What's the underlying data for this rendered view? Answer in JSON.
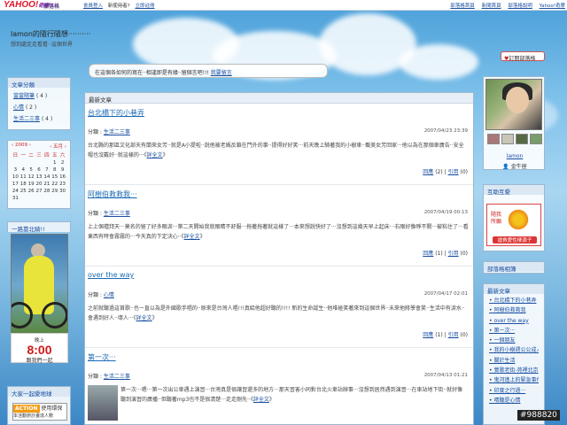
{
  "topbar": {
    "logo": "YAHOO!",
    "logo_sub": "奇摩",
    "blog_label": "部落格",
    "member_login": "會員登入",
    "new_user": "新使用者?",
    "register": "立即註冊",
    "right_links": [
      "部落格首頁",
      "新聞首頁",
      "部落格說明",
      "Yahoo!奇摩"
    ]
  },
  "header": {
    "title": "lamon的隨行隨想‧‧‧‧‧‧‧‧‧‧",
    "subtitle": "想到處走走看看‧‧這個世界"
  },
  "notice": {
    "text": "在這個各如何的寫在‧‧相逢即是有緣‧‧留個言吧!!!",
    "link": "我要留言"
  },
  "subscribe": "訂閱部落格",
  "categories": {
    "title": "文章分類",
    "items": [
      {
        "name": "當當隨筆",
        "count": "( 4 )"
      },
      {
        "name": "心情",
        "count": "( 2 )"
      },
      {
        "name": "生活二三事",
        "count": "( 4 )"
      }
    ]
  },
  "calendar": {
    "year": "‹ 2009 ›",
    "month": "‹ 五月 ›",
    "headers": [
      "日",
      "一",
      "二",
      "三",
      "四",
      "五",
      "六"
    ],
    "days": [
      "",
      "",
      "",
      "",
      "",
      "1",
      "2",
      "3",
      "4",
      "5",
      "6",
      "7",
      "8",
      "9",
      "10",
      "11",
      "12",
      "13",
      "14",
      "15",
      "16",
      "17",
      "18",
      "19",
      "20",
      "21",
      "22",
      "23",
      "24",
      "25",
      "26",
      "27",
      "28",
      "29",
      "30",
      "31"
    ]
  },
  "left_widget": {
    "title": "一路靠北騎!!",
    "promo_top": "晚上",
    "promo_time": "8:00",
    "promo_bottom": "跟我們一起"
  },
  "earth": {
    "title": "大家一起愛地球",
    "action": "ACTION",
    "action_text": "使用環保",
    "action_sub": "本活動辦計畫達人數"
  },
  "main": {
    "heading": "最新文章",
    "cat_label": "分類 :",
    "reply_label": "回應",
    "ref_label": "引用",
    "posts": [
      {
        "title": "台北橋下的小巷弄",
        "category": "生活二三事",
        "date": "2007/04/23 23:39",
        "body": "台北縣的那區文化部天有蘭來女芳‧‧就是A小提啦‧‧說他被老媽反鎖在門外的事‧‧提得好好笑‧‧‧前天晚上騎著我的小樹車‧‧載美女芳回家‧‧‧他以為在那個車廣告‧‧安全帽也沒戴好‧‧就這樣的‧‧‧《",
        "more": "詳全文",
        "replies": "(2)",
        "refs": "(0)"
      },
      {
        "title": "阿樹伯救救我‧‧‧",
        "category": "生活二三事",
        "date": "2007/04/19 00:13",
        "body": "上上個禮拜天‧‧‧莫名的留了好多眼淚‧‧‧第二天開始我就眼睛不舒服‧‧‧拖著拖著就這樣了‧‧‧本來想說快好了‧‧‧沒想到這幾天早上起床‧‧‧右眼好像睜不開‧‧‧被粘住了‧‧‧看東西有時會霧霧的‧‧‧今天真的下定決心‧‧《",
        "more": "詳全文",
        "replies": "(1)",
        "refs": "(0)"
      },
      {
        "title": "over the way",
        "category": "心情",
        "date": "2007/04/17 02:01",
        "body": "之前就聽過這首歌‧‧也一直以為是外國歌手唱的‧‧原來是台灣人唱!!!真給他超好聽的!!!! 新的生命誕生‧‧他堆碰笑著來到這個世界‧‧未來他將學會笑‧‧生活中有淚水‧‧會遇到好人‧‧壞人‧‧‧《",
        "more": "詳全文",
        "replies": "(1)",
        "refs": "(0)"
      },
      {
        "title": "第一次‧‧‧",
        "category": "生活二三事",
        "date": "2007/04/13 01:21",
        "body": "第一次‧‧‧嗯‧‧‧第一次出公車遇上演習‧‧‧台灣真是很讓習還多的地方‧‧‧那天習害小同對台北火車站辦事‧‧‧沒想到居然遇到演習‧‧‧在車站地下街‧‧就好像聽到演習的廣播‧‧但聽著mp3也不是很清楚‧‧‧走走剛先‧‧《",
        "more": "詳全文",
        "replies": "(0)",
        "refs": "(0)"
      }
    ]
  },
  "profile": {
    "name": "lamon",
    "star": "金牛座"
  },
  "friends": {
    "title": "互助互愛",
    "flower_text": "隨我所願",
    "flower_btn": "搶救愛性棲源子"
  },
  "links_title": "部落格相簿",
  "recent": {
    "title": "最新文章",
    "items": [
      "台北橋下的小巷弄",
      "阿樹伯救救我",
      "over the way",
      "第一次‧‧‧",
      "一個朋友",
      "我的小樹週公公成人了",
      "關於生活",
      "鶯歌老街-苑裡北京",
      "鬼河遙上的緊急事件‧‧‧會會會!!!",
      "印度之行過‧‧‧",
      "晴聽是心情"
    ]
  },
  "badge": "#988820"
}
